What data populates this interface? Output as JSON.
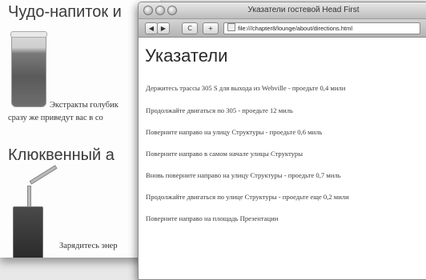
{
  "back_page": {
    "heading1": "Чудо-напиток и",
    "text1": "Экстракты голубик",
    "text2": "сразу же приведут вас в со",
    "heading2": "Клюквенный а",
    "text3": "Зарядитесь энер"
  },
  "front_window": {
    "title": "Указатели гостевой Head First",
    "toolbar": {
      "back_label": "◀",
      "forward_label": "▶",
      "reload_label": "C",
      "add_label": "+",
      "address": "file:///chapter8/lounge/about/directions.html"
    },
    "page": {
      "title": "Указатели",
      "directions": [
        "Держитесь трассы 305 S для выхода из Webville - проедьте 0,4 мили",
        "Продолжайте двигаться по 305 - проедьте 12 миль",
        "Поверните направо на улицу Структуры - проедьте 0,6 миль",
        "Поверните направо в самом начале улицы Структуры",
        "Вновь поверните направо на улицу Структуры - проедьте 0,7 миль",
        "Продолжайте двигаться по улице Структуры - проедьте еще 0,2 мили",
        "Поверните направо на площадь Презентации"
      ]
    }
  }
}
